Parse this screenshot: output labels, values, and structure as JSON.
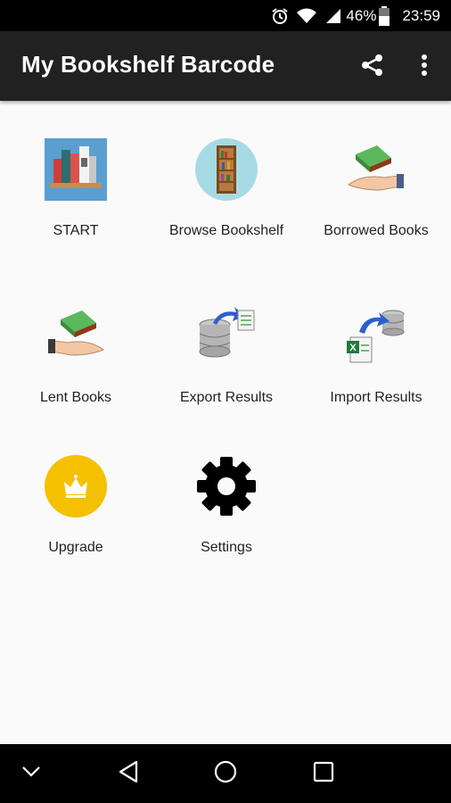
{
  "status_bar": {
    "icons": [
      "alarm-icon",
      "wifi-icon",
      "signal-icon",
      "battery-icon"
    ],
    "battery": "46%",
    "time": "23:59"
  },
  "app_bar": {
    "title": "My Bookshelf Barcode",
    "actions": [
      "share-icon",
      "overflow-menu-icon"
    ]
  },
  "menu": [
    {
      "label": "START",
      "icon": "bookshelf-icon"
    },
    {
      "label": "Browse Bookshelf",
      "icon": "bookcase-icon"
    },
    {
      "label": "Borrowed Books",
      "icon": "book-hand-icon"
    },
    {
      "label": "Lent Books",
      "icon": "book-hand-icon"
    },
    {
      "label": "Export Results",
      "icon": "database-export-icon"
    },
    {
      "label": "Import Results",
      "icon": "excel-import-icon"
    },
    {
      "label": "Upgrade",
      "icon": "crown-icon"
    },
    {
      "label": "Settings",
      "icon": "gear-icon"
    }
  ],
  "nav_bar": {
    "buttons": [
      "chevron-down-icon",
      "back-icon",
      "home-icon",
      "recents-icon"
    ]
  },
  "colors": {
    "app_bar": "#212121",
    "background": "#fafafa",
    "upgrade_gold": "#f5c000",
    "browse_circle": "#a6dbe5"
  }
}
